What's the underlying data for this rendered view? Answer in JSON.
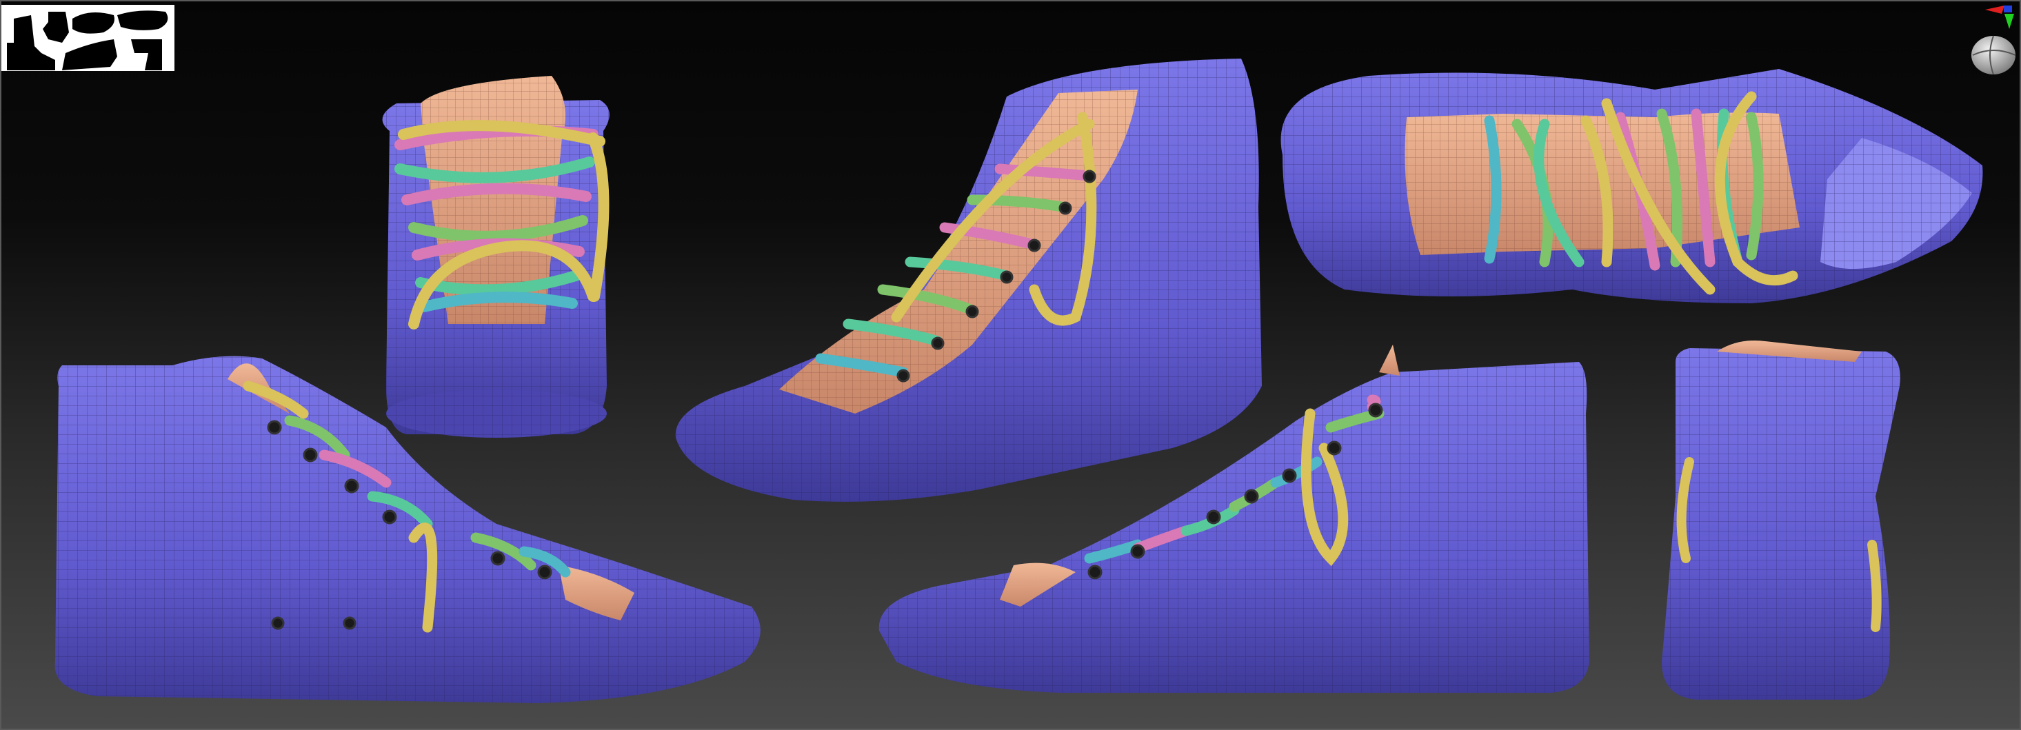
{
  "viewport": {
    "name": "3d-sculpt-viewport",
    "background": "#0b0b0b",
    "shoe_color": "#6a63d6",
    "tongue_color": "#e3a885",
    "lace_colors": [
      "#d9c35a",
      "#d979b6",
      "#58c99b",
      "#7fc46a",
      "#4fb7c6"
    ]
  },
  "icons": {
    "thumbnail": "model-thumbnail-icon",
    "gyro": "axis-gyro-icon"
  },
  "views": [
    "shoe-front-view",
    "shoe-three-quarter-view",
    "shoe-top-view",
    "shoe-side-view-left",
    "shoe-side-view-right",
    "shoe-back-view"
  ]
}
